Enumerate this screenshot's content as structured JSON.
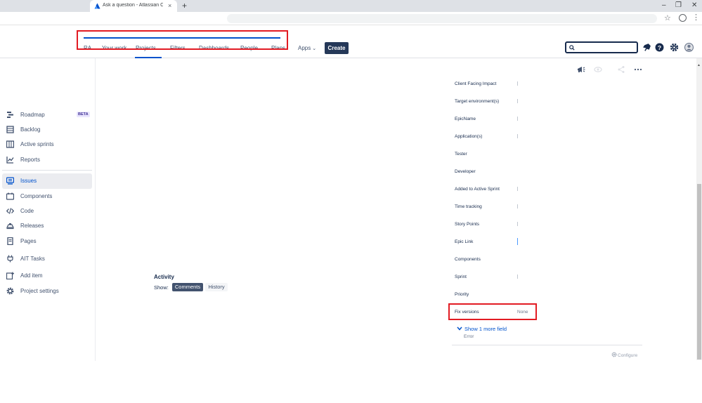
{
  "browser": {
    "tab_title": "Ask a question - Atlassian Comm",
    "new_tab": "+",
    "close_tab": "×",
    "minimize": "–",
    "restore": "❐",
    "close_window": "✕",
    "icons": [
      "atlassian-logo-icon",
      "star-icon",
      "profile-icon",
      "kebab-menu-icon"
    ]
  },
  "nav": {
    "partial": "RA",
    "your_work": "Your work",
    "projects": "Projects",
    "filters": "Filters",
    "dashboards": "Dashboards",
    "people": "People",
    "plans": "Plans",
    "apps": "Apps",
    "chevron": "⌄",
    "create": "Create",
    "search_placeholder": "",
    "icons": [
      "search-icon",
      "notification-icon",
      "help-icon",
      "settings-icon",
      "avatar-icon"
    ]
  },
  "sidebar": {
    "items": [
      {
        "label": "Roadmap",
        "icon": "roadmap-icon",
        "badge": "BETA"
      },
      {
        "label": "Backlog",
        "icon": "backlog-icon"
      },
      {
        "label": "Active sprints",
        "icon": "board-icon"
      },
      {
        "label": "Reports",
        "icon": "reports-icon"
      },
      {
        "label": "Issues",
        "icon": "issues-icon",
        "active": true
      },
      {
        "label": "Components",
        "icon": "components-icon"
      },
      {
        "label": "Code",
        "icon": "code-icon"
      },
      {
        "label": "Releases",
        "icon": "releases-icon"
      },
      {
        "label": "Pages",
        "icon": "pages-icon"
      },
      {
        "label": "AIT Tasks",
        "icon": "plugin-icon"
      },
      {
        "label": "Add item",
        "icon": "add-item-icon"
      },
      {
        "label": "Project settings",
        "icon": "gear-icon"
      }
    ]
  },
  "activity": {
    "title": "Activity",
    "show_label": "Show:",
    "comments": "Comments",
    "history": "History"
  },
  "fields": [
    {
      "label": "Client Facing Impact"
    },
    {
      "label": "Target environment(s)"
    },
    {
      "label": "EpicName"
    },
    {
      "label": "Application(s)"
    },
    {
      "label": "Tester"
    },
    {
      "label": "Developer"
    },
    {
      "label": "Added to Active Sprint"
    },
    {
      "label": "Time tracking"
    },
    {
      "label": "Story Points"
    },
    {
      "label": "Epic Link"
    },
    {
      "label": "Components"
    },
    {
      "label": "Sprint"
    },
    {
      "label": "Priority"
    },
    {
      "label": "Fix versions",
      "value": "None"
    }
  ],
  "panel": {
    "show_more": "Show 1 more field",
    "error": "Error",
    "configure": "Configure"
  },
  "colors": {
    "accent": "#0052cc",
    "annotation": "#e21b23",
    "create_bg": "#253858"
  }
}
